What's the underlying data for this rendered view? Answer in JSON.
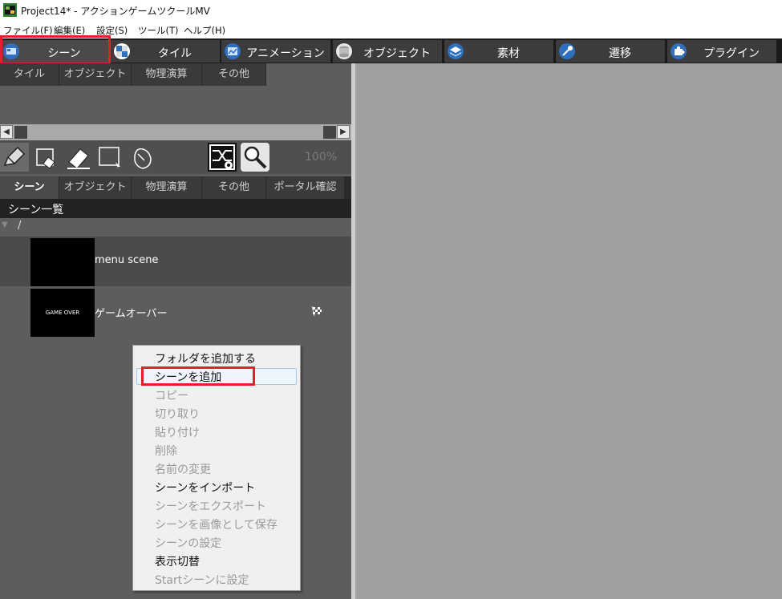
{
  "window": {
    "title": "Project14* - アクションゲームツクールMV"
  },
  "menubar": [
    "ファイル(F)",
    "編集(E)",
    "設定(S)",
    "ツール(T)",
    "ヘルプ(H)"
  ],
  "main_tabs": [
    "シーン",
    "タイル",
    "アニメーション",
    "オブジェクト",
    "素材",
    "遷移",
    "プラグイン"
  ],
  "top_subtabs": [
    "タイル",
    "オブジェクト",
    "物理演算",
    "その他"
  ],
  "toolbar": {
    "zoom": "100%"
  },
  "bottom_subtabs": [
    "シーン",
    "オブジェクト",
    "物理演算",
    "その他",
    "ポータル確認"
  ],
  "scene_list": {
    "header": "シーン一覧",
    "folder": "/",
    "scenes": [
      {
        "name": "menu scene",
        "thumb_text": ""
      },
      {
        "name": "ゲームオーバー",
        "thumb_text": "GAME OVER"
      }
    ]
  },
  "context_menu": [
    {
      "label": "フォルダを追加する",
      "enabled": true
    },
    {
      "label": "シーンを追加",
      "enabled": true
    },
    {
      "label": "コピー",
      "enabled": false
    },
    {
      "label": "切り取り",
      "enabled": false
    },
    {
      "label": "貼り付け",
      "enabled": false
    },
    {
      "label": "削除",
      "enabled": false
    },
    {
      "label": "名前の変更",
      "enabled": false
    },
    {
      "label": "シーンをインポート",
      "enabled": true
    },
    {
      "label": "シーンをエクスポート",
      "enabled": false
    },
    {
      "label": "シーンを画像として保存",
      "enabled": false
    },
    {
      "label": "シーンの設定",
      "enabled": false
    },
    {
      "label": "表示切替",
      "enabled": true
    },
    {
      "label": "Startシーンに設定",
      "enabled": false
    }
  ],
  "colors": {
    "highlight": "#e0202a",
    "panel": "#5d5d5d",
    "tabbar": "#1a1a1a"
  }
}
